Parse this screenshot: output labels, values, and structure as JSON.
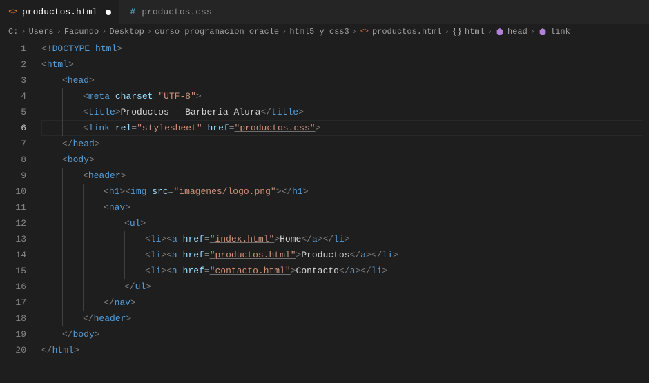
{
  "tabs": [
    {
      "name": "productos.html",
      "iconType": "html",
      "active": true,
      "modified": true
    },
    {
      "name": "productos.css",
      "iconType": "css",
      "active": false,
      "modified": false
    }
  ],
  "breadcrumb": [
    {
      "label": "C:",
      "icon": null
    },
    {
      "label": "Users",
      "icon": null
    },
    {
      "label": "Facundo",
      "icon": null
    },
    {
      "label": "Desktop",
      "icon": null
    },
    {
      "label": "curso programacion oracle",
      "icon": null
    },
    {
      "label": "html5 y css3",
      "icon": null
    },
    {
      "label": "productos.html",
      "icon": "html-file"
    },
    {
      "label": "html",
      "icon": "brace"
    },
    {
      "label": "head",
      "icon": "cube"
    },
    {
      "label": "link",
      "icon": "cube"
    }
  ],
  "lineNumbers": [
    "1",
    "2",
    "3",
    "4",
    "5",
    "6",
    "7",
    "8",
    "9",
    "10",
    "11",
    "12",
    "13",
    "14",
    "15",
    "16",
    "17",
    "18",
    "19",
    "20"
  ],
  "currentLine": 6,
  "code": {
    "l1": {
      "doctype": "DOCTYPE",
      "html": "html"
    },
    "l2": {
      "tag": "html"
    },
    "l3": {
      "tag": "head"
    },
    "l4": {
      "tag": "meta",
      "attr": "charset",
      "val": "\"UTF-8\""
    },
    "l5": {
      "tag": "title",
      "text": "Productos - Barbería Alura"
    },
    "l6": {
      "tag": "link",
      "attr1": "rel",
      "val1a": "\"s",
      "val1b": "tylesheet\"",
      "attr2": "href",
      "val2": "\"productos.css\""
    },
    "l7": {
      "tag": "head"
    },
    "l8": {
      "tag": "body"
    },
    "l9": {
      "tag": "header"
    },
    "l10": {
      "tag1": "h1",
      "tag2": "img",
      "attr": "src",
      "val": "\"imagenes/logo.png\""
    },
    "l11": {
      "tag": "nav"
    },
    "l12": {
      "tag": "ul"
    },
    "l13": {
      "tagLi": "li",
      "tagA": "a",
      "attr": "href",
      "val": "\"index.html\"",
      "text": "Home"
    },
    "l14": {
      "tagLi": "li",
      "tagA": "a",
      "attr": "href",
      "val": "\"productos.html\"",
      "text": "Productos"
    },
    "l15": {
      "tagLi": "li",
      "tagA": "a",
      "attr": "href",
      "val": "\"contacto.html\"",
      "text": "Contacto"
    },
    "l16": {
      "tag": "ul"
    },
    "l17": {
      "tag": "nav"
    },
    "l18": {
      "tag": "header"
    },
    "l19": {
      "tag": "body"
    },
    "l20": {
      "tag": "html"
    }
  }
}
